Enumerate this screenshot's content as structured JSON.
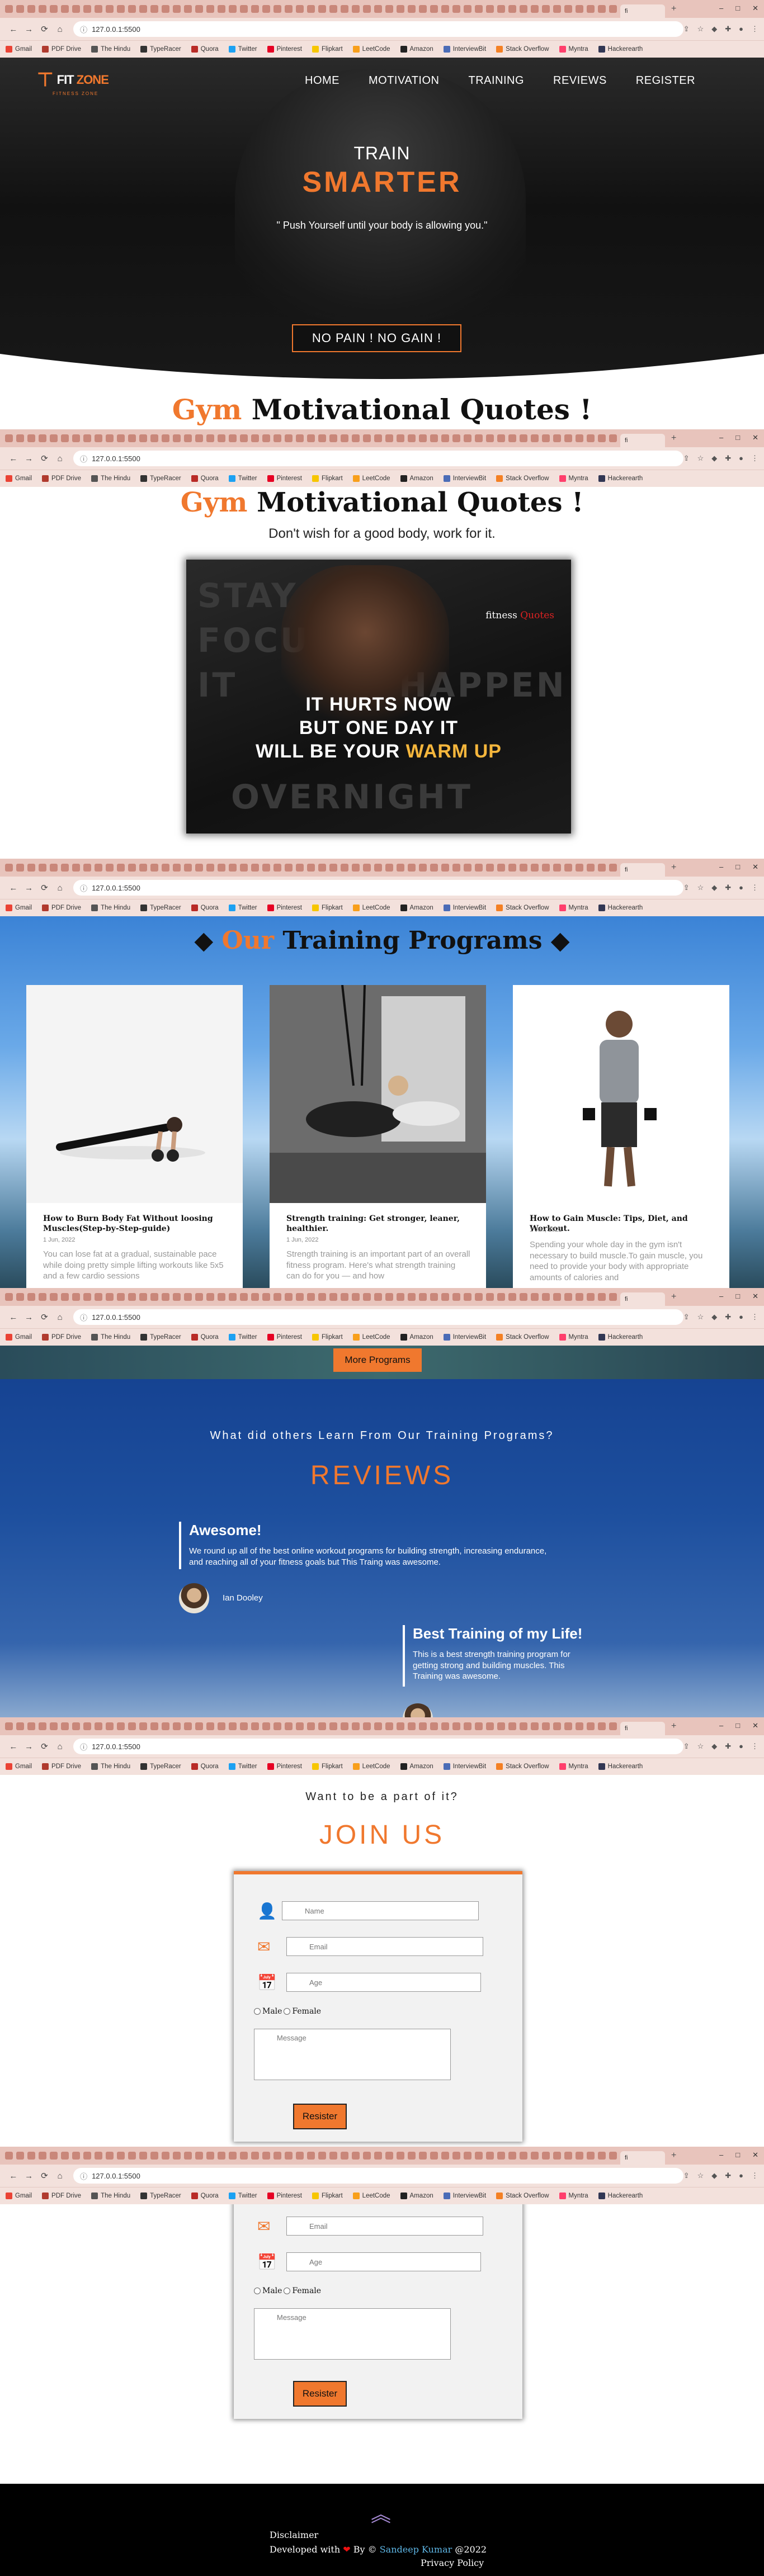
{
  "browser": {
    "tab_title": "fi",
    "new_tab": "+",
    "url": "127.0.0.1:5500",
    "nav": {
      "back": "←",
      "forward": "→",
      "reload": "⟳",
      "home": "⌂"
    },
    "window_controls": {
      "minimize": "–",
      "maximize": "□",
      "close": "✕"
    },
    "bookmarks": [
      {
        "label": "Gmail",
        "color": "#ea4335"
      },
      {
        "label": "PDF Drive",
        "color": "#b03a2e"
      },
      {
        "label": "The Hindu",
        "color": "#555555"
      },
      {
        "label": "TypeRacer",
        "color": "#333333"
      },
      {
        "label": "Quora",
        "color": "#b92b27"
      },
      {
        "label": "Twitter",
        "color": "#1da1f2"
      },
      {
        "label": "Pinterest",
        "color": "#e60023"
      },
      {
        "label": "Flipkart",
        "color": "#f7c600"
      },
      {
        "label": "LeetCode",
        "color": "#f89f1b"
      },
      {
        "label": "Amazon",
        "color": "#222222"
      },
      {
        "label": "InterviewBit",
        "color": "#4b6cb7"
      },
      {
        "label": "Stack Overflow",
        "color": "#f48024"
      },
      {
        "label": "Myntra",
        "color": "#ff3f6c"
      },
      {
        "label": "Hackerearth",
        "color": "#323754"
      }
    ]
  },
  "brand": {
    "logo_prefix": "FIT",
    "logo_suffix": "ZONE",
    "tagline": "FITNESS ZONE"
  },
  "nav": [
    "HOME",
    "MOTIVATION",
    "TRAINING",
    "REVIEWS",
    "REGISTER"
  ],
  "hero": {
    "line1": "TRAIN",
    "line2": "SMARTER",
    "quote": "\" Push Yourself until your body is allowing you.\"",
    "button": "NO PAIN ! NO GAIN !"
  },
  "quotes": {
    "title_accent": "Gym",
    "title_rest": " Motivational Quotes !",
    "subtitle": "Don't wish for a good body, work for it.",
    "poster": {
      "brand_prefix": "fitness",
      "brand_suffix": "Quotes",
      "line1": "IT HURTS NOW",
      "line2": "BUT ONE DAY IT",
      "line3_a": "WILL BE YOUR ",
      "line3_b": "WARM UP",
      "bg_words": [
        "STAY",
        "FOCUSED",
        "IT",
        "HAPPEN",
        "OVERNIGHT"
      ]
    }
  },
  "training": {
    "title_diamond": "◆",
    "title_accent": "Our",
    "title_rest": " Training Programs ",
    "cards": [
      {
        "title": "How to Burn Body Fat Without loosing Muscles(Step-by-Step-guide)",
        "date": "1 Jun, 2022",
        "text": "You can lose fat at a gradual, sustainable pace while doing pretty simple lifting workouts like 5x5 and a few cardio sessions"
      },
      {
        "title": "Strength training: Get stronger, leaner, healthier.",
        "date": "1 Jun, 2022",
        "text": "Strength training is an important part of an overall fitness program. Here's what strength training can do for you — and how"
      },
      {
        "title": "How to Gain Muscle: Tips, Diet, and Workout.",
        "date": "1 Jun, 2022",
        "text": "Spending your whole day in the gym isn't necessary to build muscle.To gain muscle, you need to provide your body with appropriate amounts of calories and"
      }
    ],
    "more_button": "More Programs"
  },
  "reviews": {
    "lead": "What did others Learn From Our Training Programs?",
    "title": "REVIEWS",
    "items": [
      {
        "heading": "Awesome!",
        "body": "We round up all of the best online workout programs for building strength, increasing endurance, and reaching all of your fitness goals but This Traing was awesome.",
        "name": "Ian Dooley"
      },
      {
        "heading": "Best Training of my Life!",
        "body": "This is a best strength training program for getting strong and building muscles. This Training was awesome.",
        "name": ""
      }
    ]
  },
  "join": {
    "lead": "Want to be a part of it?",
    "title": "JOIN US",
    "form": {
      "name_placeholder": "Name",
      "email_placeholder": "Email",
      "age_placeholder": "Age",
      "male": "Male",
      "female": "Female",
      "message_placeholder": "Message",
      "submit": "Resister"
    }
  },
  "footer": {
    "disclaimer": "Disclaimer",
    "developed_with": "Developed with ",
    "heart": "❤",
    "by": " By © ",
    "author": "Sandeep Kumar",
    "year": " @2022",
    "privacy": "Privacy Policy",
    "back_to_top": "︽"
  }
}
